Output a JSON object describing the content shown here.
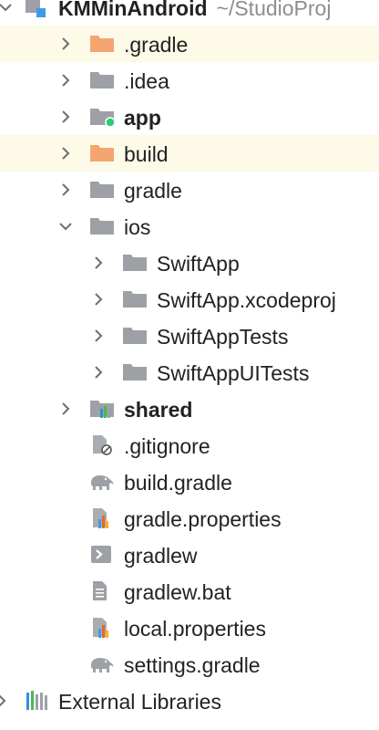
{
  "colors": {
    "highlight_row": "#fdfae7",
    "folder": "#9da1a6",
    "excluded_folder": "#f5a572",
    "module_dot": "#2dcc70",
    "text": "#222222",
    "path_text": "#8e8e8e"
  },
  "project_tree": {
    "root": {
      "label": "KMMinAndroid",
      "path": "~/StudioProj",
      "icon": "project-module-icon",
      "chevron": "expanded"
    },
    "rows": [
      {
        "label": ".gradle",
        "icon": "excluded-folder-icon",
        "chevron": "collapsed",
        "highlighted": true
      },
      {
        "label": ".idea",
        "icon": "folder-icon",
        "chevron": "collapsed"
      },
      {
        "label": "app",
        "icon": "module-folder-icon",
        "chevron": "collapsed",
        "bold": true
      },
      {
        "label": "build",
        "icon": "excluded-folder-icon",
        "chevron": "collapsed",
        "highlighted": true
      },
      {
        "label": "gradle",
        "icon": "folder-icon",
        "chevron": "collapsed"
      },
      {
        "label": "ios",
        "icon": "folder-icon",
        "chevron": "expanded"
      },
      {
        "label": "SwiftApp",
        "icon": "folder-icon",
        "chevron": "collapsed"
      },
      {
        "label": "SwiftApp.xcodeproj",
        "icon": "folder-icon",
        "chevron": "collapsed"
      },
      {
        "label": "SwiftAppTests",
        "icon": "folder-icon",
        "chevron": "collapsed"
      },
      {
        "label": "SwiftAppUITests",
        "icon": "folder-icon",
        "chevron": "collapsed"
      },
      {
        "label": "shared",
        "icon": "library-module-folder-icon",
        "chevron": "collapsed",
        "bold": true
      },
      {
        "label": ".gitignore",
        "icon": "ignored-file-icon"
      },
      {
        "label": "build.gradle",
        "icon": "gradle-elephant-icon"
      },
      {
        "label": "gradle.properties",
        "icon": "properties-file-icon"
      },
      {
        "label": "gradlew",
        "icon": "shell-script-icon"
      },
      {
        "label": "gradlew.bat",
        "icon": "text-file-icon"
      },
      {
        "label": "local.properties",
        "icon": "properties-file-icon"
      },
      {
        "label": "settings.gradle",
        "icon": "gradle-elephant-icon"
      },
      {
        "label": "External Libraries",
        "icon": "external-libraries-icon",
        "chevron": "collapsed"
      }
    ]
  }
}
